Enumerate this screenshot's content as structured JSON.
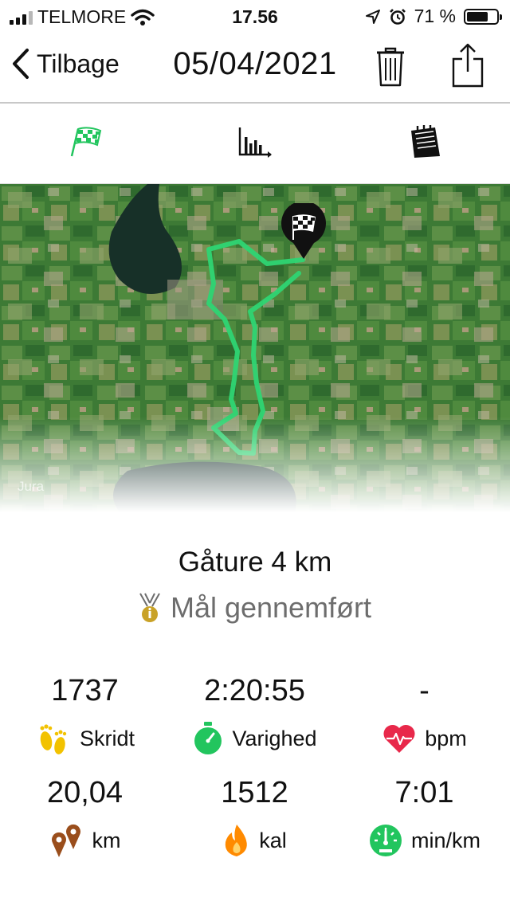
{
  "status_bar": {
    "carrier": "TELMORE",
    "time": "17.56",
    "battery_percent": "71 %",
    "battery_level": 0.71,
    "icons": [
      "signal-bars-icon",
      "wifi-icon",
      "location-arrow-icon",
      "alarm-icon",
      "battery-icon"
    ]
  },
  "nav": {
    "back_label": "Tilbage",
    "title": "05/04/2021",
    "icons": [
      "chevron-left-icon",
      "trash-icon",
      "share-icon"
    ]
  },
  "tabs": [
    {
      "name": "route",
      "icon": "checkered-flag-icon",
      "active": true
    },
    {
      "name": "graphs",
      "icon": "bar-chart-icon",
      "active": false
    },
    {
      "name": "notes",
      "icon": "notepad-icon",
      "active": false
    }
  ],
  "map": {
    "attribution": "Jura",
    "route_color": "#2ed573",
    "pin_icon": "checkered-flag-pin-icon"
  },
  "activity": {
    "title": "Gåture 4 km",
    "goal_text": "Mål gennemført",
    "goal_icon": "medal-icon"
  },
  "stats": [
    {
      "value": "1737",
      "label": "Skridt",
      "icon": "footprints-icon",
      "color": "#f2c200"
    },
    {
      "value": "2:20:55",
      "label": "Varighed",
      "icon": "stopwatch-icon",
      "color": "#22c55e"
    },
    {
      "value": "-",
      "label": "bpm",
      "icon": "heart-icon",
      "color": "#e8284a"
    },
    {
      "value": "20,04",
      "label": "km",
      "icon": "map-pins-icon",
      "color": "#9a4e1c"
    },
    {
      "value": "1512",
      "label": "kal",
      "icon": "flame-icon",
      "color": "#ff8a00"
    },
    {
      "value": "7:01",
      "label": "min/km",
      "icon": "speedometer-icon",
      "color": "#22c55e"
    }
  ]
}
